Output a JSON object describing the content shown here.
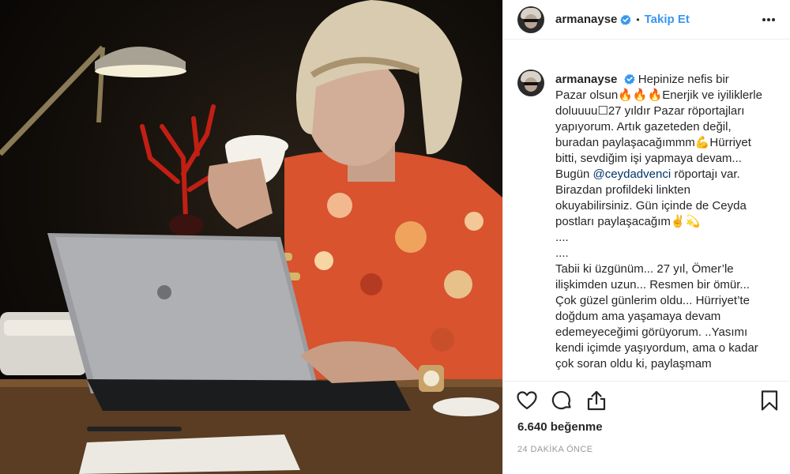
{
  "post": {
    "username": "armanayse",
    "follow_label": "Takip Et",
    "separator": "•",
    "caption_text": "Hepinize nefis bir Pazar olsun🔥🔥🔥Enerjik ve iyiliklerle doluuuu☐27 yıldır Pazar röportajları yapıyorum. Artık gazeteden değil, buradan paylaşacağımmm💪Hürriyet bitti, sevdiğim işi yapmaya devam... Bugün",
    "mention": "@ceydadvenci",
    "caption_text_2": " röportajı var. Birazdan profildeki linkten okuyabilirsiniz. Gün içinde de Ceyda postları paylaşacağım✌️💫\n....\n....\nTabii ki üzgünüm... 27 yıl, Ömer’le ilişkimden uzun... Resmen bir ömür... Çok güzel günlerim oldu... Hürriyet’te doğdum ama yaşamaya devam edemeyeceğimi görüyorum. ..Yasımı kendi içimde yaşıyordum, ama o kadar çok soran oldu ki, paylaşmam",
    "likes": "6.640 beğenme",
    "time_ago": "24 DAKİKA ÖNCE"
  },
  "icons": {
    "verified": "verified-badge-icon",
    "more": "more-options-icon",
    "like": "heart-icon",
    "comment": "comment-icon",
    "share": "share-icon",
    "save": "bookmark-icon"
  },
  "colors": {
    "accent": "#3897f0",
    "mention": "#003569",
    "text": "#262626",
    "muted": "#999999",
    "border": "#efefef"
  }
}
